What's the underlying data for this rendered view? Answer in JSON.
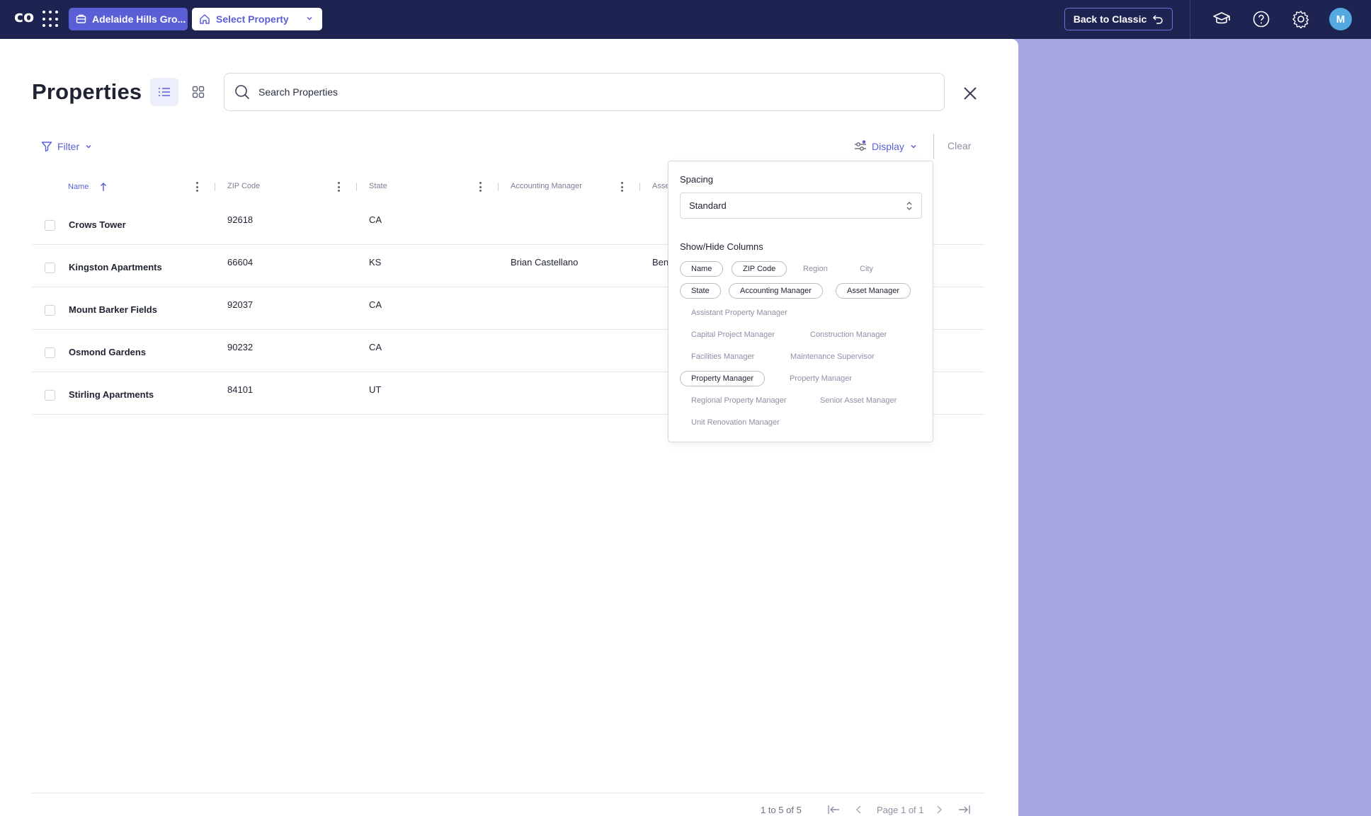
{
  "topbar": {
    "logo_text": "co",
    "portfolio_label": "Adelaide Hills Gro...",
    "property_select_label": "Select Property",
    "back_classic_label": "Back to Classic",
    "avatar_initial": "M",
    "icons": [
      "apps-grid-icon",
      "building-icon",
      "home-icon",
      "chevron-down-icon",
      "undo-arrow-icon",
      "graduation-cap-icon",
      "help-circle-icon",
      "settings-gear-icon"
    ]
  },
  "page": {
    "title": "Properties",
    "search_placeholder": "Search Properties",
    "filter_label": "Filter",
    "display_label": "Display",
    "clear_label": "Clear"
  },
  "table": {
    "columns": [
      "Name",
      "ZIP Code",
      "State",
      "Accounting Manager",
      "Asse"
    ],
    "sort": {
      "column": "Name",
      "direction": "ascending"
    },
    "rows": [
      {
        "name": "Crows Tower",
        "zip": "92618",
        "state": "CA",
        "accounting_manager": "",
        "asset_manager": ""
      },
      {
        "name": "Kingston Apartments",
        "zip": "66604",
        "state": "KS",
        "accounting_manager": "Brian Castellano",
        "asset_manager": "Ben"
      },
      {
        "name": "Mount Barker Fields",
        "zip": "92037",
        "state": "CA",
        "accounting_manager": "",
        "asset_manager": ""
      },
      {
        "name": "Osmond Gardens",
        "zip": "90232",
        "state": "CA",
        "accounting_manager": "",
        "asset_manager": ""
      },
      {
        "name": "Stirling Apartments",
        "zip": "84101",
        "state": "UT",
        "accounting_manager": "",
        "asset_manager": ""
      }
    ]
  },
  "display_menu": {
    "spacing_label": "Spacing",
    "spacing_value": "Standard",
    "columns_label": "Show/Hide Columns",
    "chips": [
      {
        "label": "Name",
        "on": true
      },
      {
        "label": "ZIP Code",
        "on": true
      },
      {
        "label": "Region",
        "on": false
      },
      {
        "label": "City",
        "on": false
      },
      {
        "label": "State",
        "on": true
      },
      {
        "label": "Accounting Manager",
        "on": true
      },
      {
        "label": "Asset Manager",
        "on": true
      },
      {
        "label": "Assistant Property Manager",
        "on": false
      },
      {
        "label": "Capital Project Manager",
        "on": false
      },
      {
        "label": "Construction Manager",
        "on": false
      },
      {
        "label": "Facilities Manager",
        "on": false
      },
      {
        "label": "Maintenance Supervisor",
        "on": false
      },
      {
        "label": "Property Manager",
        "on": true
      },
      {
        "label": "Property Manager",
        "on": false
      },
      {
        "label": "Regional Property Manager",
        "on": false
      },
      {
        "label": "Senior Asset Manager",
        "on": false
      },
      {
        "label": "Unit Renovation Manager",
        "on": false
      }
    ]
  },
  "pagination": {
    "range": "1 to 5 of 5",
    "page": "Page 1 of 1"
  },
  "colors": {
    "topbar": "#1e2452",
    "accent": "#5b5fd6",
    "backdrop": "#a4a5e2",
    "avatar": "#53a9e0"
  }
}
